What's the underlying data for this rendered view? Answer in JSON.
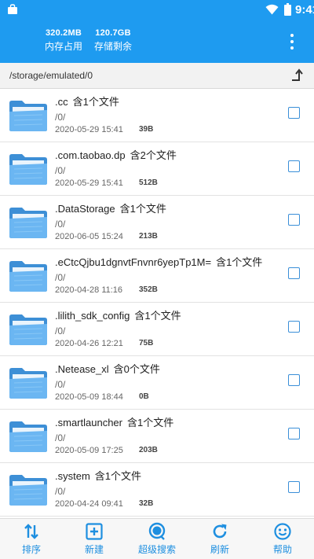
{
  "status_bar": {
    "time": "9:41"
  },
  "header": {
    "stats": [
      {
        "value": "320.2MB",
        "label": "内存占用"
      },
      {
        "value": "120.7GB",
        "label": "存储剩余"
      }
    ],
    "menu_icon": "more-vertical-icon"
  },
  "path_bar": {
    "path": "/storage/emulated/0",
    "up_icon": "arrow-up-level-icon"
  },
  "files": [
    {
      "name": ".cc",
      "count": "含1个文件",
      "path": "/0/",
      "date": "2020-05-29 15:41",
      "size": "39B"
    },
    {
      "name": ".com.taobao.dp",
      "count": "含2个文件",
      "path": "/0/",
      "date": "2020-05-29 15:41",
      "size": "512B"
    },
    {
      "name": ".DataStorage",
      "count": "含1个文件",
      "path": "/0/",
      "date": "2020-06-05 15:24",
      "size": "213B"
    },
    {
      "name": ".eCtcQjbu1dgnvtFnvnr6yepTp1M=",
      "count": "含1个文件",
      "path": "/0/",
      "date": "2020-04-28 11:16",
      "size": "352B"
    },
    {
      "name": ".lilith_sdk_config",
      "count": "含1个文件",
      "path": "/0/",
      "date": "2020-04-26 12:21",
      "size": "75B"
    },
    {
      "name": ".Netease_xl",
      "count": "含0个文件",
      "path": "/0/",
      "date": "2020-05-09 18:44",
      "size": "0B"
    },
    {
      "name": ".smartlauncher",
      "count": "含1个文件",
      "path": "/0/",
      "date": "2020-05-09 17:25",
      "size": "203B"
    },
    {
      "name": ".system",
      "count": "含1个文件",
      "path": "/0/",
      "date": "2020-04-24 09:41",
      "size": "32B"
    }
  ],
  "bottom_nav": [
    {
      "label": "排序",
      "icon": "sort-icon"
    },
    {
      "label": "新建",
      "icon": "add-box-icon"
    },
    {
      "label": "超级搜索",
      "icon": "search-icon"
    },
    {
      "label": "刷新",
      "icon": "refresh-icon"
    },
    {
      "label": "帮助",
      "icon": "smiley-icon"
    }
  ],
  "colors": {
    "primary": "#1E9BF0",
    "folder": "#5AAEF0",
    "checkbox": "#3A8FD8",
    "nav": "#1E8FE0"
  }
}
